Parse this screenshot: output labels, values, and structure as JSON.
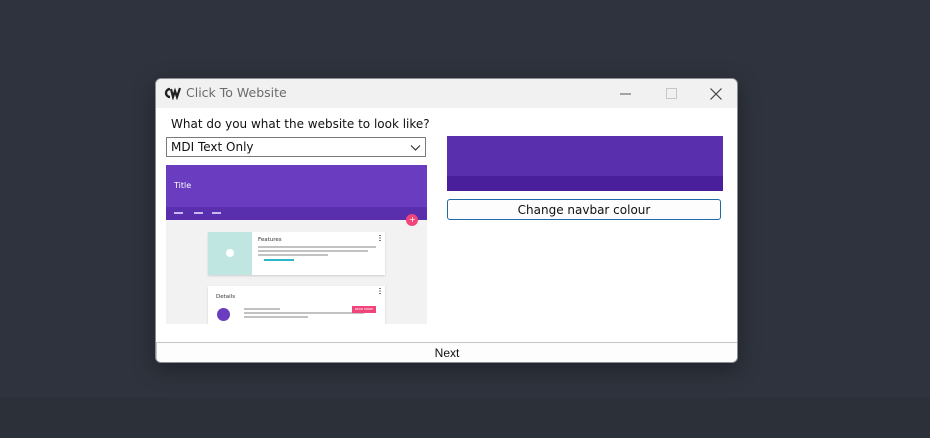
{
  "window": {
    "title": "Click To Website",
    "logo_text": "CTW"
  },
  "form": {
    "question": "What do you what the website to look like?",
    "template_select": {
      "value": "MDI Text Only"
    }
  },
  "preview": {
    "title": "Title",
    "card1_title": "Features",
    "card2_title": "Details",
    "pink_button": "READ MORE"
  },
  "navbar": {
    "change_button": "Change navbar colour",
    "color_top": "#5a2fae",
    "color_bottom": "#4a1f9c"
  },
  "footer": {
    "next_button": "Next"
  },
  "icons": [
    "app-logo-icon",
    "minimize-icon",
    "maximize-icon",
    "close-icon",
    "chevron-down-icon"
  ]
}
